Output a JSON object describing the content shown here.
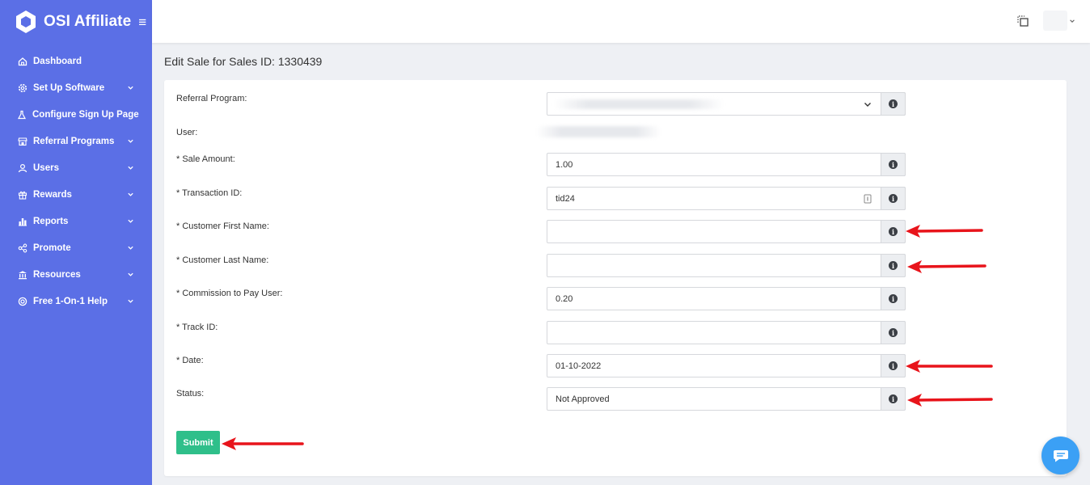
{
  "brand": {
    "name": "OSI Affiliate",
    "menu_icon": "hamburger-icon"
  },
  "colors": {
    "sidebar": "#5b6fe6",
    "submit": "#2fbf8a",
    "arrow": "#e8141b",
    "chat": "#3ba0f5"
  },
  "sidebar": {
    "items": [
      {
        "label": "Dashboard",
        "icon": "home-icon",
        "has_submenu": false
      },
      {
        "label": "Set Up Software",
        "icon": "settings-icon",
        "has_submenu": true
      },
      {
        "label": "Configure Sign Up Page",
        "icon": "flask-icon",
        "has_submenu": false
      },
      {
        "label": "Referral Programs",
        "icon": "store-icon",
        "has_submenu": true
      },
      {
        "label": "Users",
        "icon": "user-icon",
        "has_submenu": true
      },
      {
        "label": "Rewards",
        "icon": "gift-icon",
        "has_submenu": true
      },
      {
        "label": "Reports",
        "icon": "bar-chart-icon",
        "has_submenu": true
      },
      {
        "label": "Promote",
        "icon": "share-icon",
        "has_submenu": true
      },
      {
        "label": "Resources",
        "icon": "bank-icon",
        "has_submenu": true
      },
      {
        "label": "Free 1-On-1 Help",
        "icon": "lifebuoy-icon",
        "has_submenu": true
      }
    ]
  },
  "page": {
    "title": "Edit Sale for Sales ID: 1330439"
  },
  "form": {
    "referral_program_label": "Referral Program:",
    "user_label": "User:",
    "sale_amount_label": "* Sale Amount:",
    "sale_amount_value": "1.00",
    "transaction_id_label": "* Transaction ID:",
    "transaction_id_value": "tid24",
    "first_name_label": "* Customer First Name:",
    "first_name_value": "",
    "last_name_label": "* Customer Last Name:",
    "last_name_value": "",
    "commission_label": "* Commission to Pay User:",
    "commission_value": "0.20",
    "track_id_label": "* Track ID:",
    "track_id_value": "",
    "date_label": "* Date:",
    "date_value": "01-10-2022",
    "status_label": "Status:",
    "status_value": "Not Approved",
    "submit_label": "Submit"
  }
}
